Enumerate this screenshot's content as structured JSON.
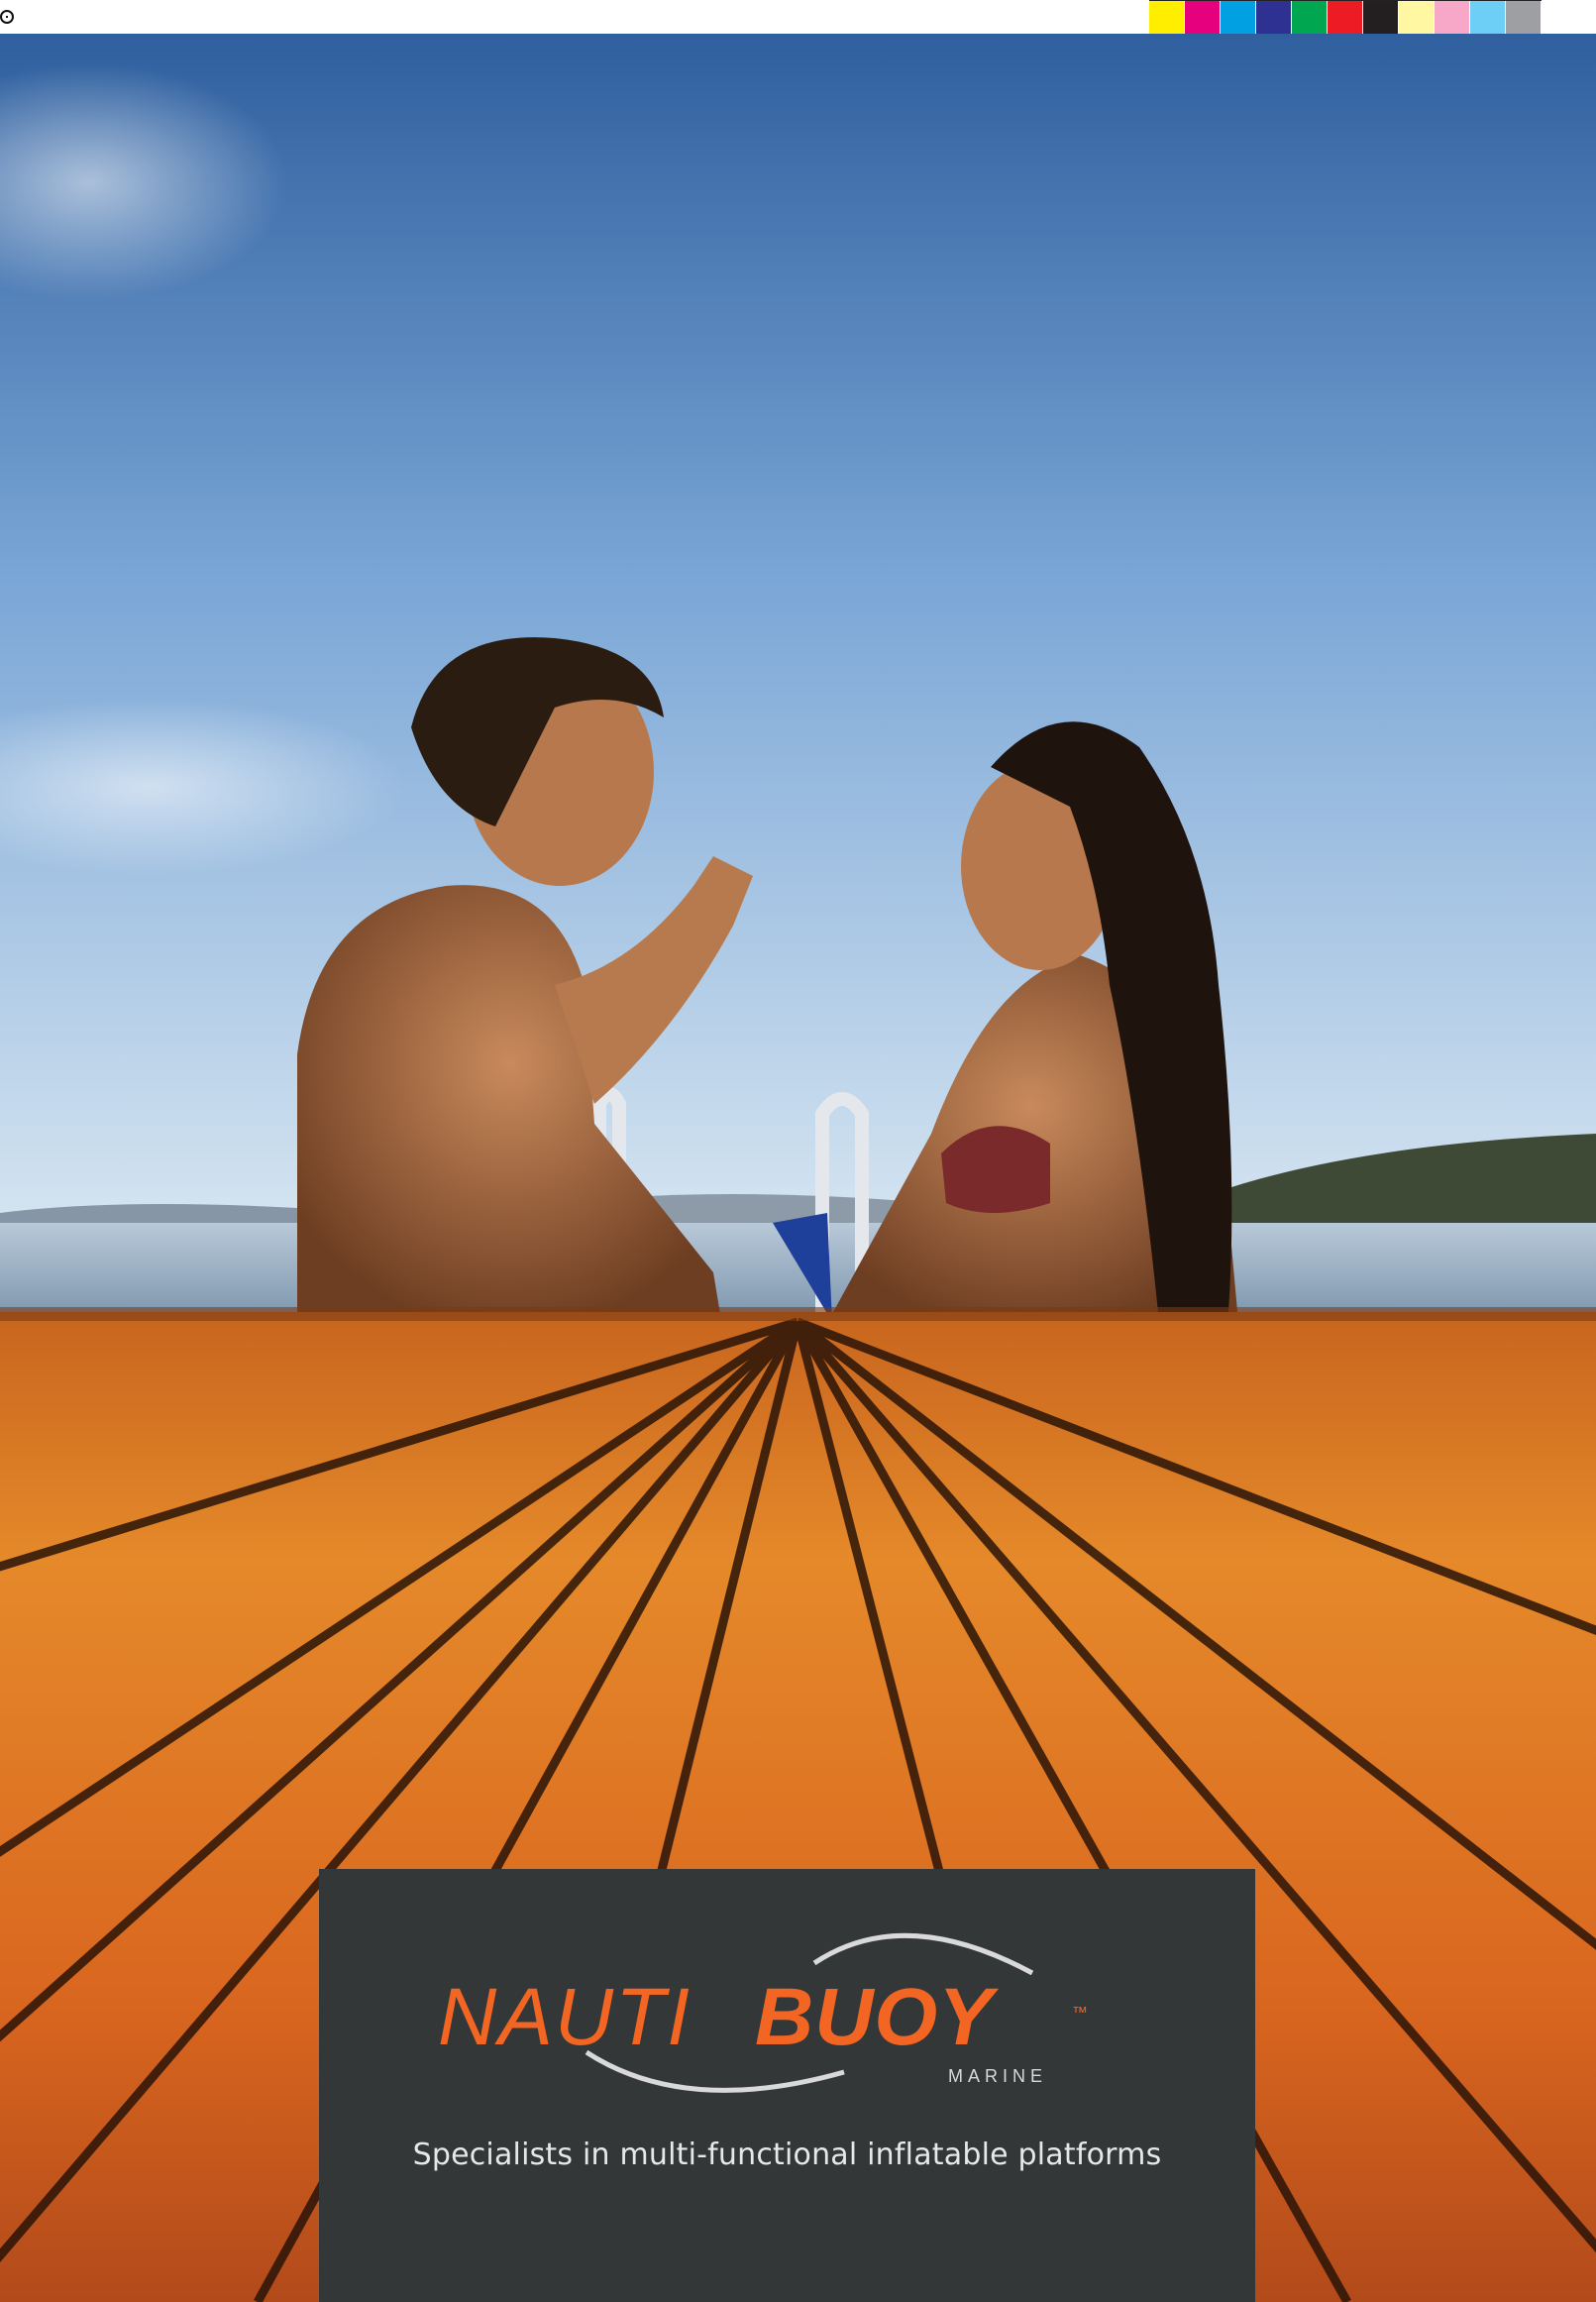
{
  "colors": {
    "accent": "#f26522",
    "panel": "#333738",
    "sky_top": "#2f5f9e",
    "sky_bottom": "#cfe1f0",
    "deck": "#e07a1f"
  },
  "color_bar": [
    "#ffee00",
    "#e6007e",
    "#00a0e3",
    "#2e3192",
    "#00a650",
    "#ed1c24",
    "#231f20",
    "#fff7a1",
    "#f7a8c8",
    "#6dcff6",
    "#9d9fa2"
  ],
  "photo": {
    "subject": "couple-in-water-by-inflatable-deck"
  },
  "brand": {
    "name_part1": "NAUTI",
    "name_part2": "BUOY",
    "trademark": "™",
    "subtitle": "MARINE",
    "tagline": "Specialists in multi-functional inflatable platforms"
  }
}
